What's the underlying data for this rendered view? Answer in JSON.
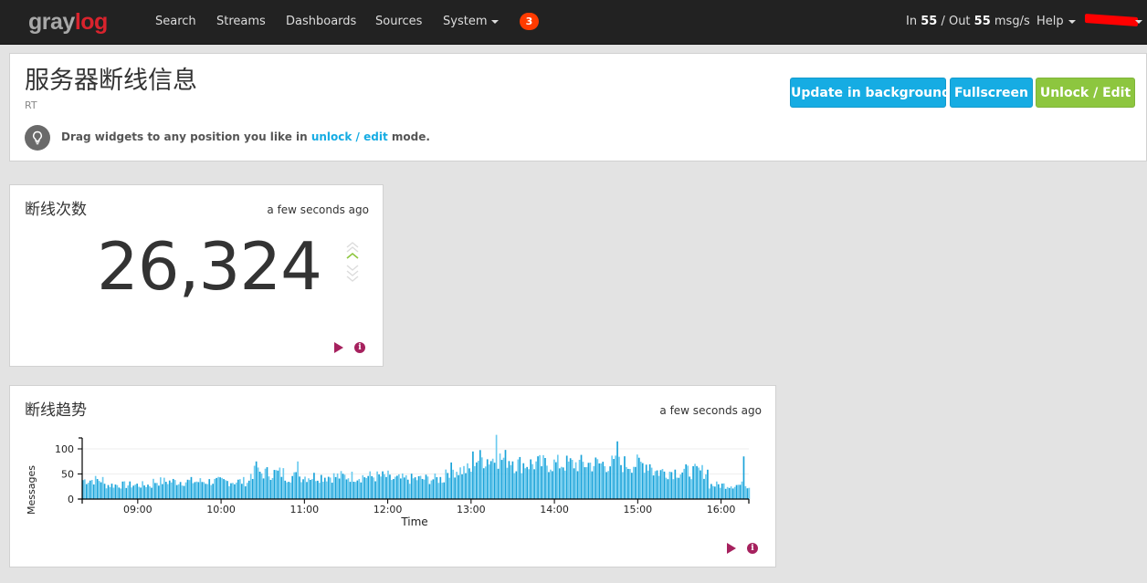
{
  "navbar": {
    "logo_part1": "gray",
    "logo_part2": "log",
    "items": [
      {
        "label": "Search"
      },
      {
        "label": "Streams"
      },
      {
        "label": "Dashboards"
      },
      {
        "label": "Sources"
      },
      {
        "label": "System",
        "dropdown": true
      }
    ],
    "notification_count": "3",
    "throughput": {
      "prefix_in": "In ",
      "in": "55",
      "sep": " / Out ",
      "out": "55",
      "suffix": " msg/s"
    },
    "help_label": "Help",
    "user_label": "(redacted)"
  },
  "dashboard": {
    "title": "服务器断线信息",
    "description": "RT",
    "hint_prefix": "Drag widgets to any position you like in ",
    "hint_link": "unlock / edit",
    "hint_suffix": " mode.",
    "buttons": {
      "update_background": "Update in background",
      "fullscreen": "Fullscreen",
      "unlock_edit": "Unlock / Edit"
    }
  },
  "widgets": [
    {
      "title": "断线次数",
      "updated": "a few seconds ago",
      "value": "26,324",
      "trend": "up",
      "colors": {
        "trend_active": "#8dc63f",
        "trend_inactive": "#d8d8d8"
      }
    },
    {
      "title": "断线趋势",
      "updated": "a few seconds ago"
    }
  ],
  "colors": {
    "accent_blue": "#16ace3",
    "accent_green": "#8dc63f",
    "action_purple": "#a6215e",
    "bar_dark": "#1aa3d9",
    "bar_light": "#6ccbef"
  },
  "chart_data": {
    "type": "bar",
    "title": "断线趋势",
    "xlabel": "Time",
    "ylabel": "Messages",
    "x_start": "08:20",
    "x_end": "16:19",
    "x_ticks": [
      "09:00",
      "10:00",
      "11:00",
      "12:00",
      "13:00",
      "14:00",
      "15:00",
      "16:00"
    ],
    "y_ticks": [
      0,
      50,
      100
    ],
    "ylim": [
      0,
      130
    ],
    "grid": true,
    "bucket_minutes": 1.3,
    "segments": [
      {
        "from": "08:20",
        "to": "08:35",
        "avg": 38
      },
      {
        "from": "08:35",
        "to": "09:10",
        "avg": 28
      },
      {
        "from": "09:10",
        "to": "10:20",
        "avg": 35
      },
      {
        "from": "10:20",
        "to": "10:45",
        "avg": 52
      },
      {
        "from": "10:45",
        "to": "12:00",
        "avg": 45
      },
      {
        "from": "12:00",
        "to": "12:40",
        "avg": 40
      },
      {
        "from": "12:40",
        "to": "13:00",
        "avg": 58
      },
      {
        "from": "13:00",
        "to": "13:30",
        "avg": 80
      },
      {
        "from": "13:30",
        "to": "15:10",
        "avg": 70
      },
      {
        "from": "15:10",
        "to": "15:50",
        "avg": 55
      },
      {
        "from": "15:50",
        "to": "16:19",
        "avg": 28
      }
    ],
    "peaks": [
      {
        "time": "10:25",
        "value": 75
      },
      {
        "time": "10:55",
        "value": 75
      },
      {
        "time": "13:18",
        "value": 128
      },
      {
        "time": "14:45",
        "value": 115
      },
      {
        "time": "16:16",
        "value": 85
      }
    ]
  }
}
